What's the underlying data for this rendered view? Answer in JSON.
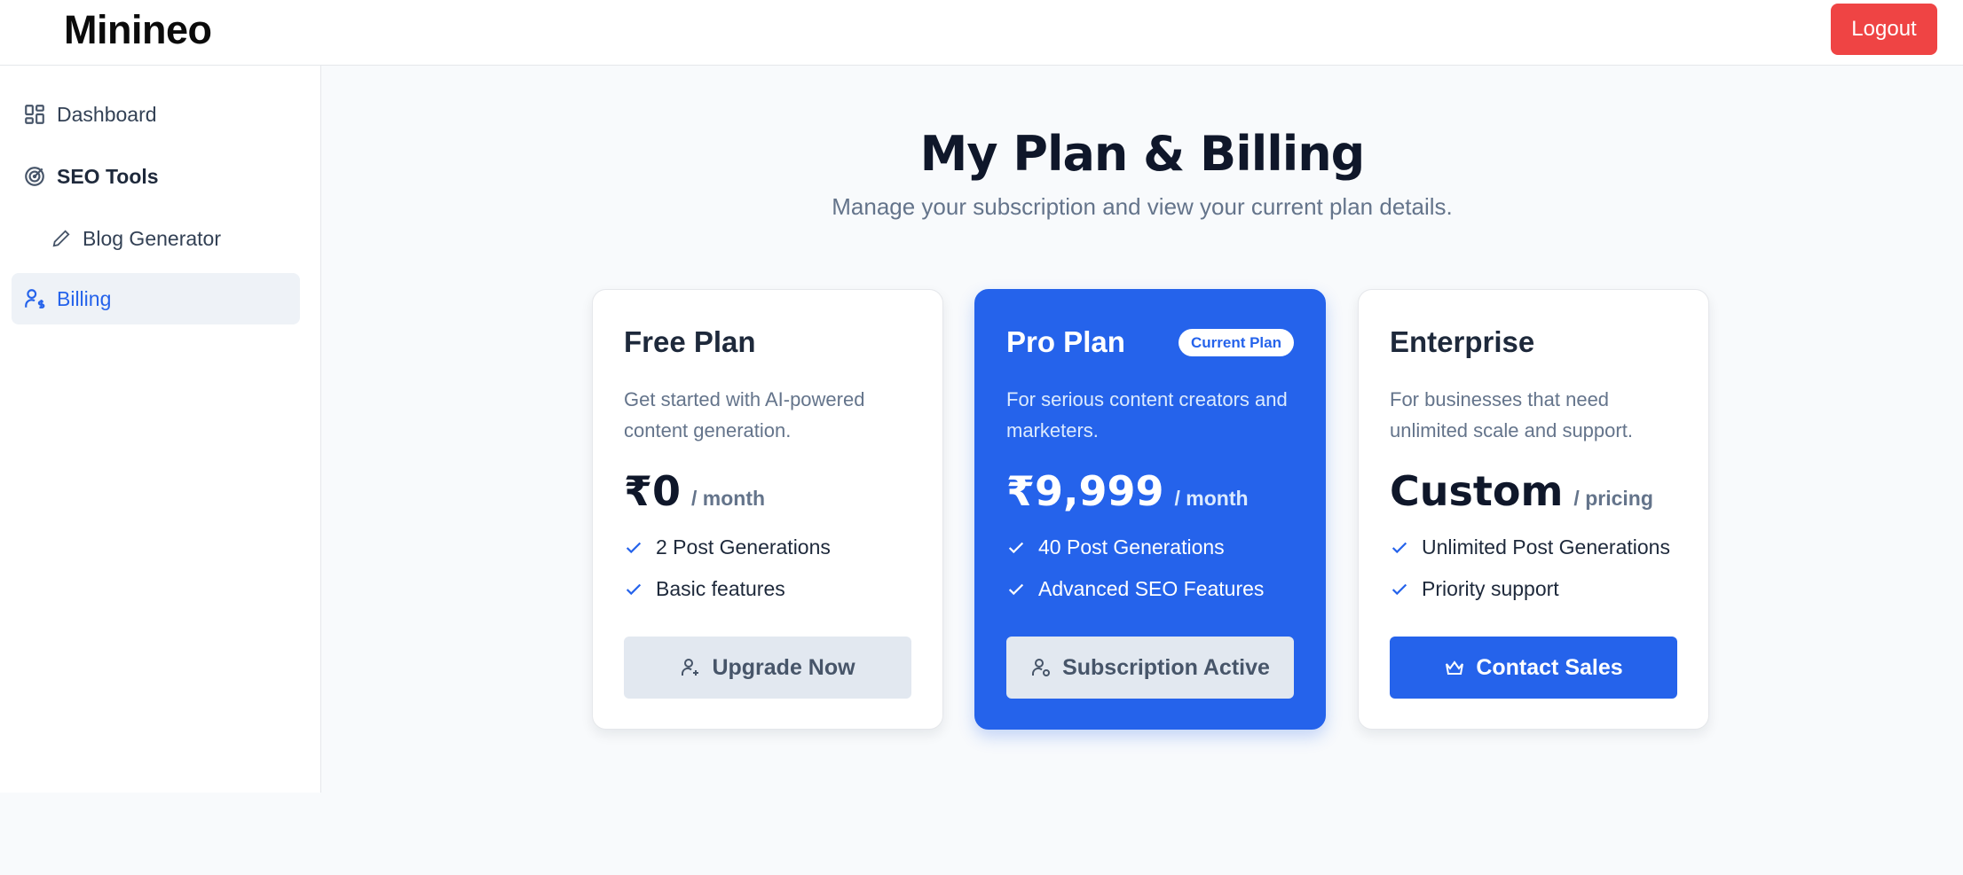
{
  "header": {
    "logo": "Minineo",
    "logout_label": "Logout"
  },
  "sidebar": {
    "items": [
      {
        "label": "Dashboard",
        "icon": "dashboard-icon"
      },
      {
        "label": "SEO Tools",
        "icon": "target-icon"
      },
      {
        "label": "Blog Generator",
        "icon": "pencil-icon"
      },
      {
        "label": "Billing",
        "icon": "user-dollar-icon",
        "active": true
      }
    ]
  },
  "main": {
    "title": "My Plan & Billing",
    "subtitle": "Manage your subscription and view your current plan details."
  },
  "plans": [
    {
      "name": "Free Plan",
      "description": "Get started with AI-powered content generation.",
      "price": "₹0",
      "period": "/ month",
      "features": [
        "2 Post Generations",
        "Basic features"
      ],
      "button_label": "Upgrade Now",
      "button_icon": "user-plus-icon"
    },
    {
      "name": "Pro Plan",
      "badge": "Current Plan",
      "description": "For serious content creators and marketers.",
      "price": "₹9,999",
      "period": "/ month",
      "features": [
        "40 Post Generations",
        "Advanced SEO Features"
      ],
      "button_label": "Subscription Active",
      "button_icon": "user-check-icon"
    },
    {
      "name": "Enterprise",
      "description": "For businesses that need unlimited scale and support.",
      "price": "Custom",
      "period": "/ pricing",
      "features": [
        "Unlimited Post Generations",
        "Priority support"
      ],
      "button_label": "Contact Sales",
      "button_icon": "crown-icon"
    }
  ],
  "colors": {
    "accent": "#2563eb",
    "danger": "#ef4444",
    "background": "#f8fafc"
  }
}
